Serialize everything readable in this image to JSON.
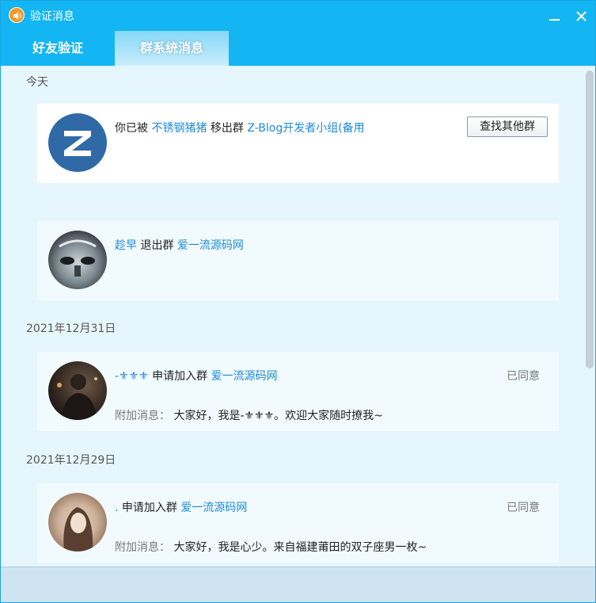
{
  "window": {
    "title": "验证消息",
    "app_icon": "speaker-icon",
    "minimize_icon": "minimize-icon",
    "close_icon": "close-icon"
  },
  "tabs": [
    {
      "label": "好友验证",
      "active": false
    },
    {
      "label": "群系统消息",
      "active": true
    }
  ],
  "sections": [
    {
      "date": "今天"
    },
    {
      "date": "2021年12月31日"
    },
    {
      "date": "2021年12月29日"
    }
  ],
  "messages": [
    {
      "avatar_icon": "z-blog-logo",
      "pre": "你已被",
      "actor": "不锈钢猪猪",
      "action": "移出群",
      "group": "Z-Blog开发者小组(备用",
      "button": "查找其他群"
    },
    {
      "avatar_icon": "robot-avatar",
      "actor": "趁早",
      "action": "退出群",
      "group": "爱一流源码网"
    },
    {
      "avatar_icon": "person-avatar",
      "actor": "-⚜⚜⚜",
      "action": "申请加入群",
      "group": "爱一流源码网",
      "status": "已同意",
      "extra_label": "附加消息：",
      "extra_text": "大家好，我是-⚜⚜⚜。欢迎大家随时撩我~"
    },
    {
      "avatar_icon": "girl-avatar",
      "actor": ".",
      "action": "申请加入群",
      "group": "爱一流源码网",
      "status": "已同意",
      "extra_label": "附加消息：",
      "extra_text": "大家好，我是心少。来自福建莆田的双子座男一枚~"
    }
  ],
  "colors": {
    "titlebar": "#13b5f2",
    "link": "#1e8ad6",
    "content_bg": "#e6f6fd"
  }
}
